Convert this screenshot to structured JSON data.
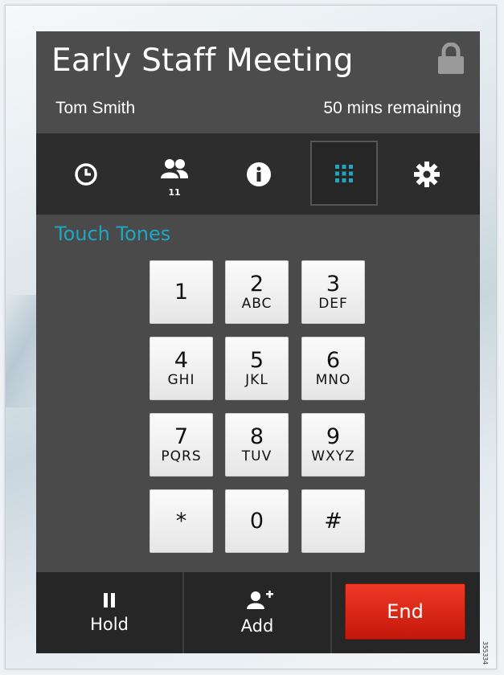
{
  "meeting": {
    "title": "Early Staff Meeting",
    "organizer": "Tom Smith",
    "time_remaining": "50 mins remaining",
    "lock_icon": "lock-icon"
  },
  "tabs": [
    {
      "name": "history",
      "icon": "clock-icon",
      "active": false
    },
    {
      "name": "participants",
      "icon": "people-icon",
      "count": "11",
      "active": false
    },
    {
      "name": "info",
      "icon": "info-icon",
      "active": false
    },
    {
      "name": "keypad",
      "icon": "keypad-icon",
      "active": true
    },
    {
      "name": "settings",
      "icon": "gear-icon",
      "active": false
    }
  ],
  "keypad": {
    "section_title": "Touch Tones",
    "keys": [
      {
        "digit": "1",
        "letters": ""
      },
      {
        "digit": "2",
        "letters": "ABC"
      },
      {
        "digit": "3",
        "letters": "DEF"
      },
      {
        "digit": "4",
        "letters": "GHI"
      },
      {
        "digit": "5",
        "letters": "JKL"
      },
      {
        "digit": "6",
        "letters": "MNO"
      },
      {
        "digit": "7",
        "letters": "PQRS"
      },
      {
        "digit": "8",
        "letters": "TUV"
      },
      {
        "digit": "9",
        "letters": "WXYZ"
      },
      {
        "digit": "*",
        "letters": ""
      },
      {
        "digit": "0",
        "letters": ""
      },
      {
        "digit": "#",
        "letters": ""
      }
    ]
  },
  "footer": {
    "hold_label": "Hold",
    "add_label": "Add",
    "end_label": "End"
  },
  "figure_id": "355334",
  "colors": {
    "accent": "#1ea7c4",
    "end_button": "#d9220f",
    "panel": "#4a4a4a",
    "tabbar": "#2d2d2d"
  }
}
